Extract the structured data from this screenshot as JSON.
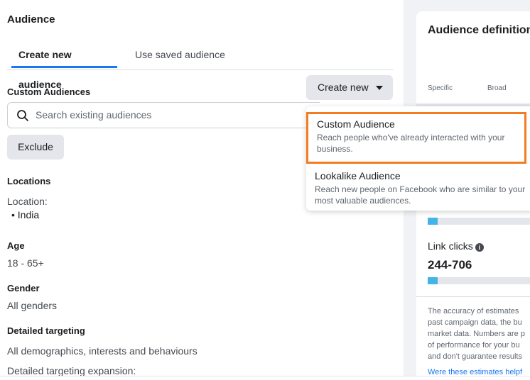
{
  "audience_panel": {
    "title": "Audience",
    "tabs": [
      "Create new audience",
      "Use saved audience"
    ],
    "custom_audiences_label": "Custom Audiences",
    "create_new_label": "Create new",
    "search_placeholder": "Search existing audiences",
    "exclude_label": "Exclude",
    "locations_label": "Locations",
    "location_prefix": "Location:",
    "location_value": "India",
    "age_label": "Age",
    "age_value": "18 - 65+",
    "gender_label": "Gender",
    "gender_value": "All genders",
    "detailed_targeting_label": "Detailed targeting",
    "detailed_targeting_value": "All demographics, interests and behaviours",
    "detailed_expansion_label": "Detailed targeting expansion:"
  },
  "dropdown": {
    "items": [
      {
        "title": "Custom Audience",
        "description": "Reach people who've already interacted with your business."
      },
      {
        "title": "Lookalike Audience",
        "description": "Reach new people on Facebook who are similar to your most valuable audiences."
      }
    ]
  },
  "definition_card": {
    "title": "Audience definition",
    "specific_label": "Specific",
    "broad_label": "Broad",
    "link_clicks_label": "Link clicks",
    "link_clicks_value": "244-706",
    "disclaimer_lines": [
      "The accuracy of estimates",
      "past campaign data, the bu",
      "market data. Numbers are p",
      "of performance for your bu",
      "and don't guarantee results"
    ],
    "feedback_link": "Were these estimates helpf"
  },
  "colors": {
    "accent": "#1877f2",
    "highlight_border": "#f47c20",
    "bar_fill": "#43b4e5"
  }
}
